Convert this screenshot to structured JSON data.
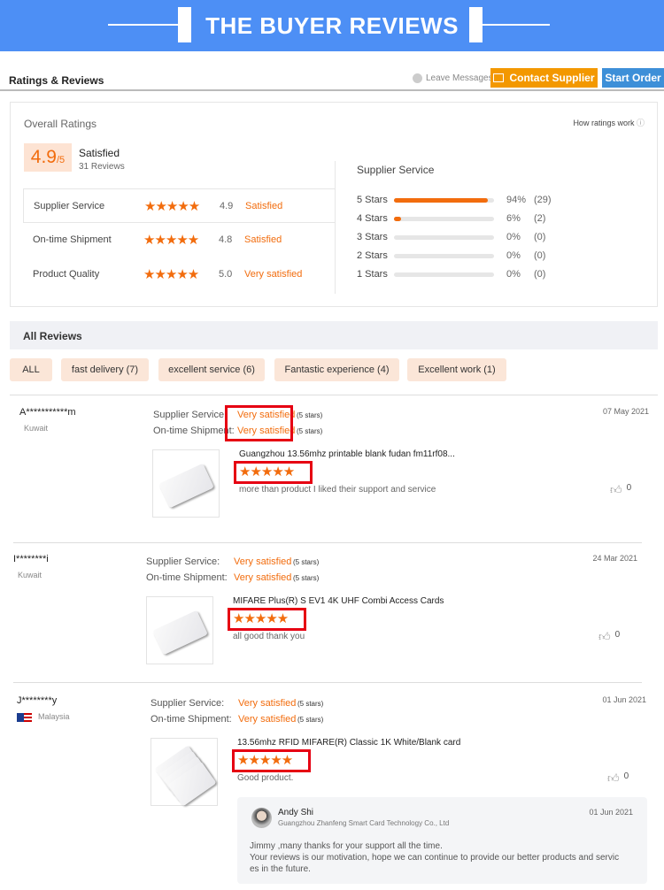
{
  "banner": {
    "title": "THE BUYER REVIEWS"
  },
  "header": {
    "title": "Ratings & Reviews",
    "leave_messages": "Leave Messages",
    "contact_supplier": "Contact Supplier",
    "start_order": "Start Order"
  },
  "overall": {
    "title": "Overall Ratings",
    "how_ratings": "How ratings work",
    "score": "4.9",
    "score_max": "/5",
    "label": "Satisfied",
    "count": "31 Reviews",
    "rows": [
      {
        "name": "Supplier Service",
        "value": "4.9",
        "label": "Satisfied",
        "stars": 5
      },
      {
        "name": "On-time Shipment",
        "value": "4.8",
        "label": "Satisfied",
        "stars": 5
      },
      {
        "name": "Product Quality",
        "value": "5.0",
        "label": "Very satisfied",
        "stars": 5
      }
    ],
    "breakdown_title": "Supplier Service",
    "breakdown": [
      {
        "label": "5 Stars",
        "percent": 94,
        "percent_text": "94%",
        "count": "(29)"
      },
      {
        "label": "4 Stars",
        "percent": 6,
        "percent_text": "6%",
        "count": "(2)"
      },
      {
        "label": "3 Stars",
        "percent": 0,
        "percent_text": "0%",
        "count": "(0)"
      },
      {
        "label": "2 Stars",
        "percent": 0,
        "percent_text": "0%",
        "count": "(0)"
      },
      {
        "label": "1 Stars",
        "percent": 0,
        "percent_text": "0%",
        "count": "(0)"
      }
    ]
  },
  "all_reviews": {
    "title": "All Reviews",
    "tags": [
      "ALL",
      "fast delivery (7)",
      "excellent service (6)",
      "Fantastic experience (4)",
      "Excellent work (1)"
    ]
  },
  "labels": {
    "supplier_service": "Supplier Service:",
    "shipment": "On-time Shipment:",
    "five_stars": "(5 stars)",
    "stars": "★★★★★"
  },
  "reviews": [
    {
      "user": "A***********m",
      "country": "Kuwait",
      "date": "07 May 2021",
      "supplier": "Very satisfied",
      "shipment": "Very satisfied",
      "product": "Guangzhou 13.56mhz printable blank fudan fm11rf08...",
      "comment": "more than product I liked their support and service",
      "likes": "0"
    },
    {
      "user": "I********i",
      "country": "Kuwait",
      "date": "24 Mar 2021",
      "supplier": "Very satisfied",
      "shipment": "Very satisfied",
      "product": "MIFARE Plus(R) S EV1 4K UHF Combi Access Cards",
      "comment": "all good thank you",
      "likes": "0"
    },
    {
      "user": "J********y",
      "country": "Malaysia",
      "date": "01 Jun 2021",
      "supplier": "Very satisfied",
      "shipment": "Very satisfied",
      "product": "13.56mhz RFID MIFARE(R) Classic 1K White/Blank card",
      "comment": "Good product.",
      "likes": "0",
      "reply": {
        "name": "Andy Shi",
        "company": "Guangzhou Zhanfeng Smart Card Technology Co., Ltd",
        "date": "01 Jun 2021",
        "lines": [
          "Jimmy ,many thanks for your support all the time.",
          "Your reviews is our motivation, hope we can continue to provide our better products and servic",
          "es in the future."
        ]
      }
    }
  ],
  "colors": {
    "accent": "#f26c0d",
    "banner": "#4d8ff5",
    "contact": "#f39800",
    "start": "#3d8fd8",
    "highlight": "#e60012"
  }
}
